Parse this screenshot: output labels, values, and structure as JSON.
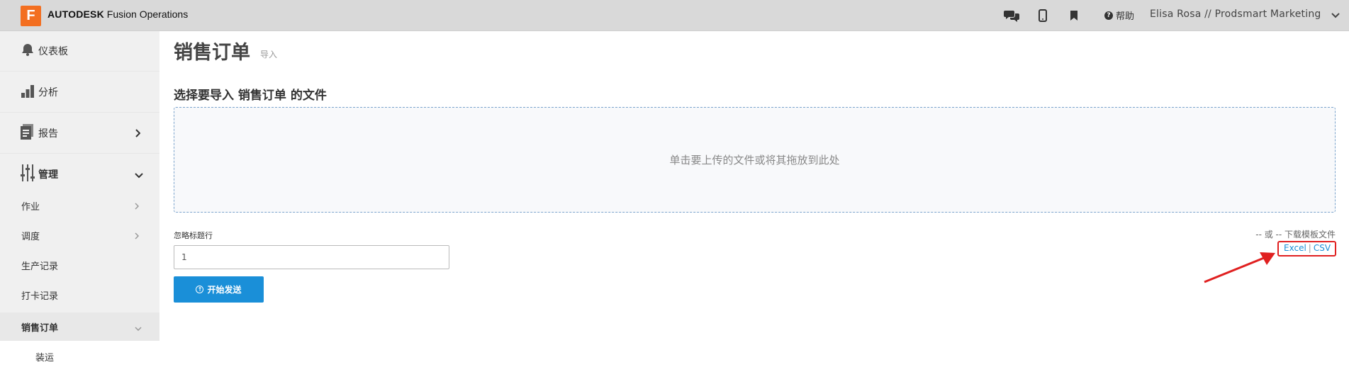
{
  "header": {
    "logo_letter": "F",
    "brand_bold": "AUTODESK",
    "brand_rest": " Fusion Operations",
    "help_label": "帮助",
    "user_label": "Elisa Rosa // Prodsmart Marketing",
    "icons": [
      "chat-icon",
      "mobile-icon",
      "bookmark-icon",
      "help-icon",
      "chevron-down-icon"
    ]
  },
  "sidebar": {
    "items": [
      {
        "label": "仪表板",
        "icon": "bell-icon"
      },
      {
        "label": "分析",
        "icon": "bar-chart-icon"
      },
      {
        "label": "报告",
        "icon": "document-icon"
      },
      {
        "label": "管理",
        "icon": "sliders-icon"
      }
    ],
    "sub_items": [
      {
        "label": "作业"
      },
      {
        "label": "调度"
      },
      {
        "label": "生产记录"
      },
      {
        "label": "打卡记录"
      },
      {
        "label": "销售订单"
      },
      {
        "label": "装运"
      }
    ]
  },
  "main": {
    "title": "销售订单",
    "subtitle": "导入",
    "section_title": "选择要导入 销售订单 的文件",
    "dropzone_text": "单击要上传的文件或将其拖放到此处",
    "ignore_label": "忽略标题行",
    "ignore_value": "1",
    "start_button": "开始发送",
    "or_text": "-- 或 -- 下载模板文件",
    "excel_link": "Excel",
    "pipe": "|",
    "csv_link": "CSV"
  },
  "colors": {
    "accent": "#1a8fd8",
    "logo": "#f36f21",
    "highlight": "#e02020"
  }
}
